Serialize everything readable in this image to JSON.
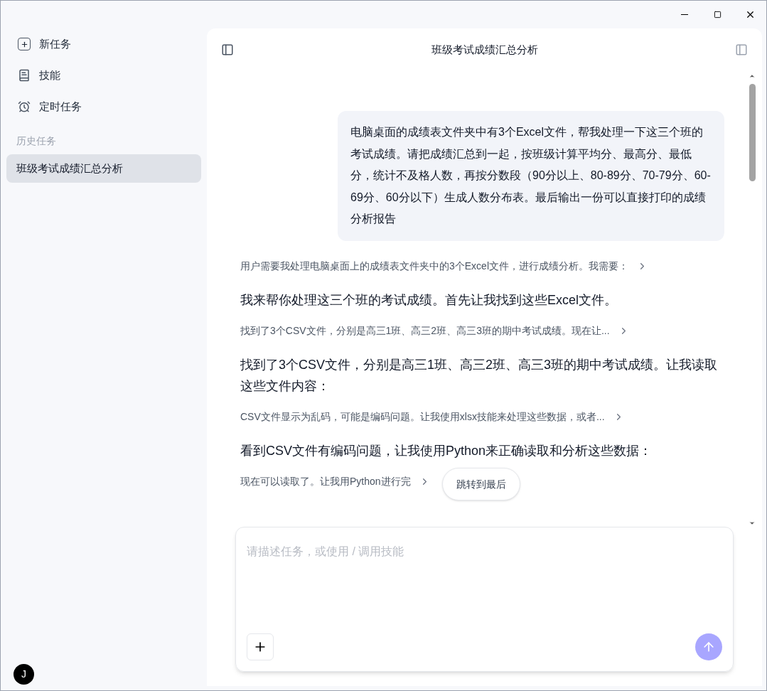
{
  "sidebar": {
    "items": [
      {
        "label": "新任务",
        "kind": "new"
      },
      {
        "label": "技能",
        "kind": "skills"
      },
      {
        "label": "定时任务",
        "kind": "schedule"
      }
    ],
    "history_heading": "历史任务",
    "history": [
      {
        "label": "班级考试成绩汇总分析",
        "selected": true
      }
    ],
    "avatar": "J"
  },
  "header": {
    "title": "班级考试成绩汇总分析"
  },
  "messages": [
    {
      "kind": "user",
      "text": "电脑桌面的成绩表文件夹中有3个Excel文件，帮我处理一下这三个班的考试成绩。请把成绩汇总到一起，按班级计算平均分、最高分、最低分，统计不及格人数，再按分数段（90分以上、80-89分、70-79分、60-69分、60分以下）生成人数分布表。最后输出一份可以直接打印的成绩分析报告"
    },
    {
      "kind": "step",
      "text": "用户需要我处理电脑桌面上的成绩表文件夹中的3个Excel文件，进行成绩分析。我需要："
    },
    {
      "kind": "reply",
      "text": "我来帮你处理这三个班的考试成绩。首先让我找到这些Excel文件。"
    },
    {
      "kind": "step",
      "text": "找到了3个CSV文件，分别是高三1班、高三2班、高三3班的期中考试成绩。现在让..."
    },
    {
      "kind": "reply",
      "text": "找到了3个CSV文件，分别是高三1班、高三2班、高三3班的期中考试成绩。让我读取这些文件内容："
    },
    {
      "kind": "step",
      "text": "CSV文件显示为乱码，可能是编码问题。让我使用xlsx技能来处理这些数据，或者..."
    },
    {
      "kind": "reply",
      "text": "看到CSV文件有编码问题，让我使用Python来正确读取和分析这些数据："
    },
    {
      "kind": "step",
      "text": "现在可以读取了。让我用Python进行完"
    }
  ],
  "jump_button": "跳转到最后",
  "composer": {
    "placeholder": "请描述任务，或使用 / 调用技能"
  }
}
